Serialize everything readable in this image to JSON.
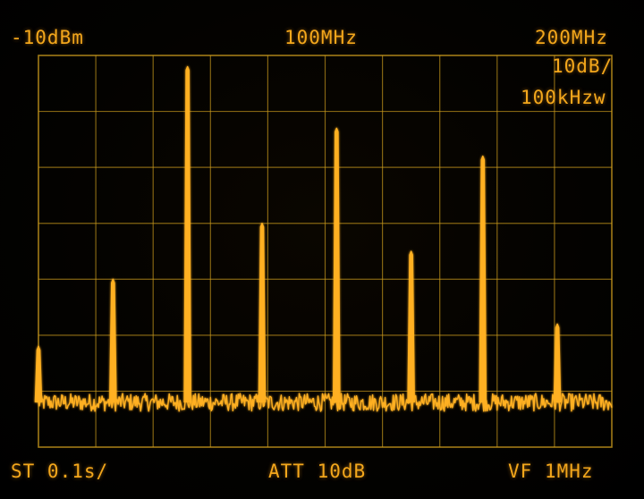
{
  "display": {
    "ref_level": "-10dBm",
    "center_freq": "100MHz",
    "span": "200MHz",
    "scale": "10dB/",
    "rbw": "100kHzw",
    "sweep_time": "ST 0.1s/",
    "attenuation": "ATT 10dB",
    "video_filter": "VF 1MHz"
  },
  "colors": {
    "trace": "#ffb020",
    "grid": "#c99a1c",
    "text": "#f3a71c",
    "background": "#000000"
  },
  "chart_data": {
    "type": "line",
    "title": "",
    "xlabel": "",
    "ylabel": "",
    "x_unit": "MHz",
    "y_unit": "dBm",
    "xlim": [
      0,
      200
    ],
    "ylim": [
      -80,
      -10
    ],
    "grid": true,
    "grid_divisions": {
      "x": 10,
      "y": 7
    },
    "noise_floor_dbm": -72,
    "series": [
      {
        "peaks": [
          {
            "freq_mhz": 0,
            "level_dbm": -62
          },
          {
            "freq_mhz": 26,
            "level_dbm": -50
          },
          {
            "freq_mhz": 52,
            "level_dbm": -12
          },
          {
            "freq_mhz": 78,
            "level_dbm": -40
          },
          {
            "freq_mhz": 104,
            "level_dbm": -23
          },
          {
            "freq_mhz": 130,
            "level_dbm": -45
          },
          {
            "freq_mhz": 155,
            "level_dbm": -28
          },
          {
            "freq_mhz": 181,
            "level_dbm": -58
          }
        ]
      }
    ]
  }
}
